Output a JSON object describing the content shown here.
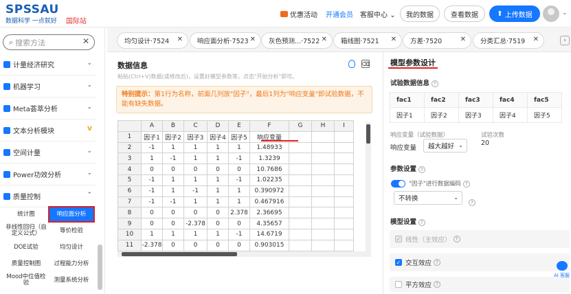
{
  "header": {
    "logo": "SPSSAU",
    "slogan": "数据科学 一点就好",
    "intl": "国际站",
    "promo": "优惠活动",
    "vip": "开通会员",
    "service": "客服中心",
    "service_arrow": "⌄",
    "my_data": "我的数据",
    "view_data": "查看数据",
    "upload": "上传数据",
    "upload_icon": "⬆",
    "avatar_dropdown": "⌄"
  },
  "sidebar": {
    "search_placeholder": "搜索方法",
    "search_icon": "⌕",
    "clear_icon": "✕",
    "items": [
      {
        "label": "计量经济研究",
        "icon": "chart-icon",
        "arrow": "⌄"
      },
      {
        "label": "机器学习",
        "icon": "gear-icon",
        "arrow": "⌄"
      },
      {
        "label": "Meta荟萃分析",
        "icon": "meta-icon",
        "arrow": "⌄"
      },
      {
        "label": "文本分析模块",
        "icon": "text-icon",
        "arrow": "V"
      },
      {
        "label": "空间计量",
        "icon": "space-icon",
        "arrow": "⌄"
      },
      {
        "label": "Power功效分析",
        "icon": "power-icon",
        "arrow": "⌄"
      },
      {
        "label": "质量控制",
        "icon": "quality-icon",
        "arrow": "⌃"
      }
    ],
    "tiles": [
      "统计图",
      "响应面分析",
      "非线性回归（自定义公式）",
      "等价检验",
      "DOE试验",
      "均匀设计",
      "质量控制图",
      "过程能力分析",
      "Mood中位值检验",
      "测量系统分析"
    ]
  },
  "tabs": [
    {
      "label": "均匀设计·7524",
      "close": "✕"
    },
    {
      "label": "响应面分析·7523",
      "close": "✕"
    },
    {
      "label": "灰色预测...·7522",
      "close": "✕"
    },
    {
      "label": "箱线图·7521",
      "close": "✕"
    },
    {
      "label": "方差·7520",
      "close": "✕"
    },
    {
      "label": "分类汇总·7519",
      "close": "✕"
    }
  ],
  "tab_more": "›",
  "data_panel": {
    "title": "数据信息",
    "hint": "粘贴(Ctrl+V)数据(或修改后)，设置好模型参数等，点击\"开始分析\"即可。",
    "clear_icon": "⌫",
    "notice_prefix": "特别提示：",
    "notice_text": "第1行为名称，前面几列放\"因子\"，最后1列为\"响应变量\"即试验数据，不能有缺失数据。",
    "col_headers": [
      "",
      "A",
      "B",
      "C",
      "D",
      "E",
      "F",
      "G",
      "H",
      "I"
    ],
    "rows": [
      [
        "1",
        "因子1",
        "因子2",
        "因子3",
        "因子4",
        "因子5",
        "响应变量",
        "",
        "",
        ""
      ],
      [
        "2",
        "-1",
        "1",
        "1",
        "1",
        "1",
        "1.48933",
        "",
        "",
        ""
      ],
      [
        "3",
        "1",
        "-1",
        "1",
        "1",
        "-1",
        "1.3239",
        "",
        "",
        ""
      ],
      [
        "4",
        "0",
        "0",
        "0",
        "0",
        "0",
        "10.7686",
        "",
        "",
        ""
      ],
      [
        "5",
        "-1",
        "1",
        "1",
        "1",
        "-1",
        "1.02235",
        "",
        "",
        ""
      ],
      [
        "6",
        "-1",
        "1",
        "-1",
        "1",
        "1",
        "0.390972",
        "",
        "",
        ""
      ],
      [
        "7",
        "-1",
        "-1",
        "1",
        "1",
        "1",
        "0.467916",
        "",
        "",
        ""
      ],
      [
        "8",
        "0",
        "0",
        "0",
        "0",
        "2.378",
        "2.36695",
        "",
        "",
        ""
      ],
      [
        "9",
        "0",
        "0",
        "-2.378",
        "0",
        "0",
        "4.35657",
        "",
        "",
        ""
      ],
      [
        "10",
        "1",
        "1",
        "1",
        "1",
        "-1",
        "14.6719",
        "",
        "",
        ""
      ],
      [
        "11",
        "-2.378",
        "0",
        "0",
        "0",
        "0",
        "0.903015",
        "",
        "",
        ""
      ]
    ],
    "scroll_left": "◂",
    "scroll_right": "▸"
  },
  "model_panel": {
    "title": "模型参数设计",
    "trial_info_label": "试验数据信息",
    "factors_header": [
      "fac1",
      "fac2",
      "fac3",
      "fac4",
      "fac5"
    ],
    "factors": [
      "因子1",
      "因子2",
      "因子3",
      "因子4",
      "因子5"
    ],
    "response_label": "响应变量（试验数据）",
    "response_value": "响应变量",
    "direction": "越大越好",
    "trials_label": "试验次数",
    "trials_value": "20",
    "params_label": "参数设置",
    "encode_label": "\"因子\"进行数据编码",
    "encode_value": "不转换",
    "model_settings_label": "模型设置",
    "options": [
      {
        "label": "线性（主效应）",
        "state": "disabled"
      },
      {
        "label": "交互效应",
        "state": "on"
      },
      {
        "label": "平方效应",
        "state": "off"
      }
    ],
    "help_icon": "?",
    "check_mark": "✓",
    "dropdown_arrow": "⌄"
  },
  "ai_button": "AI 客服"
}
